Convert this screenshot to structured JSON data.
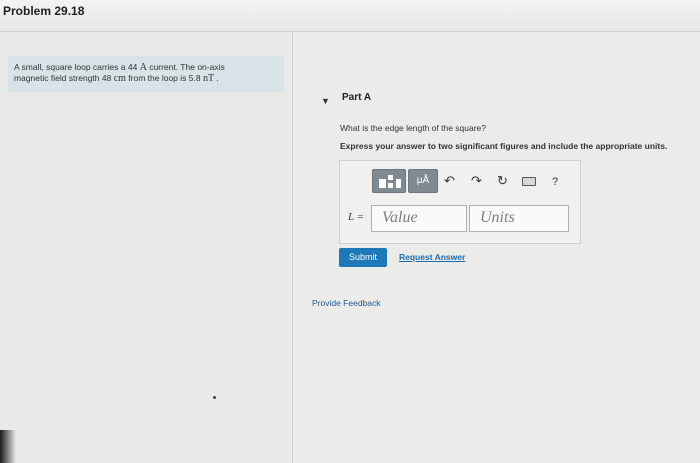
{
  "header": {
    "title": "Problem 29.18"
  },
  "problem": {
    "text_1": "A small, square loop carries a 44 ",
    "current_unit": "A",
    "text_2": " current. The on-axis",
    "text_3": "magnetic field strength 48 ",
    "distance_unit": "cm",
    "text_4": " from the loop is 5.8 ",
    "field_unit": "nT",
    "text_5": " ."
  },
  "part": {
    "toggle_icon": "triangle-down",
    "label": "Part A"
  },
  "question": "What is the edge length of the square?",
  "instruction": "Express your answer to two significant figures and include the appropriate units.",
  "toolbar": {
    "templates_icon": "templates-icon",
    "units_label": "μÅ",
    "undo_glyph": "↶",
    "redo_glyph": "↷",
    "reset_glyph": "↻",
    "keyboard_icon": "keyboard-icon",
    "help_label": "?"
  },
  "answer": {
    "variable_label": "L =",
    "value_placeholder": "Value",
    "units_placeholder": "Units"
  },
  "actions": {
    "submit_label": "Submit",
    "request_answer_label": "Request Answer"
  },
  "footer": {
    "feedback_label": "Provide Feedback"
  },
  "colors": {
    "submit_bg": "#1e79b8",
    "link": "#1e6aa8",
    "toolbar_btn": "#7f8a93",
    "problem_bg": "#d7e3e6"
  }
}
